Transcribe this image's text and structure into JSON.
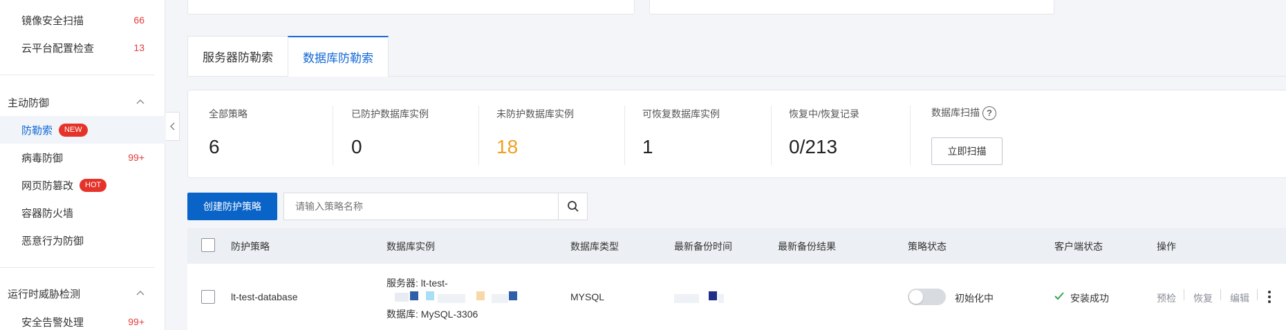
{
  "sidebar": {
    "items_top": [
      {
        "label": "镜像安全扫描",
        "count": "66"
      },
      {
        "label": "云平台配置检查",
        "count": "13"
      }
    ],
    "group_active_defense": "主动防御",
    "active_defense_items": [
      {
        "label": "防勒索",
        "badge": "NEW",
        "count": ""
      },
      {
        "label": "病毒防御",
        "badge": "",
        "count": "99+"
      },
      {
        "label": "网页防篡改",
        "badge": "HOT",
        "count": ""
      },
      {
        "label": "容器防火墙",
        "badge": "",
        "count": ""
      },
      {
        "label": "恶意行为防御",
        "badge": "",
        "count": ""
      }
    ],
    "group_runtime": "运行时威胁检测",
    "runtime_items": [
      {
        "label": "安全告警处理",
        "count": "99+"
      }
    ]
  },
  "tabs": [
    "服务器防勒索",
    "数据库防勒索"
  ],
  "stats": {
    "all_policies": {
      "label": "全部策略",
      "value": "6"
    },
    "protected": {
      "label": "已防护数据库实例",
      "value": "0"
    },
    "unprotected": {
      "label": "未防护数据库实例",
      "value": "18"
    },
    "recoverable": {
      "label": "可恢复数据库实例",
      "value": "1"
    },
    "recovering": {
      "label": "恢复中/恢复记录",
      "value": "0/213"
    },
    "scan": {
      "label": "数据库扫描",
      "button": "立即扫描"
    }
  },
  "toolbar": {
    "create_button": "创建防护策略",
    "search_placeholder": "请输入策略名称"
  },
  "table": {
    "headers": [
      "防护策略",
      "数据库实例",
      "数据库类型",
      "最新备份时间",
      "最新备份结果",
      "策略状态",
      "客户端状态",
      "操作"
    ],
    "rows": [
      {
        "policy": "lt-test-database",
        "instance_server": "服务器: lt-test-",
        "instance_db": "数据库: MySQL-3306",
        "db_type": "MYSQL",
        "backup_result": "",
        "policy_status": "初始化中",
        "client_status": "安装成功",
        "ops": [
          "预检",
          "恢复",
          "编辑"
        ]
      }
    ]
  },
  "colors": {
    "primary": "#0a64c8",
    "warning": "#f0a020",
    "danger": "#e6332a",
    "success": "#2fa84f"
  }
}
